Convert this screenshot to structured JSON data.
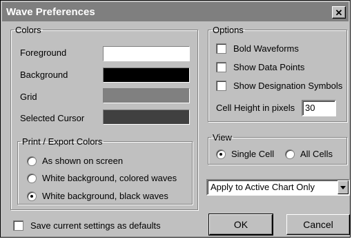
{
  "window": {
    "title": "Wave Preferences",
    "close_glyph": "✕"
  },
  "colors_group": {
    "legend": "Colors",
    "rows": [
      {
        "label": "Foreground",
        "color": "#ffffff"
      },
      {
        "label": "Background",
        "color": "#000000"
      },
      {
        "label": "Grid",
        "color": "#808080"
      },
      {
        "label": "Selected Cursor",
        "color": "#404040"
      }
    ],
    "print_export": {
      "legend": "Print / Export Colors",
      "options": [
        {
          "label": "As shown on screen",
          "selected": false
        },
        {
          "label": "White background, colored waves",
          "selected": false
        },
        {
          "label": "White background, black waves",
          "selected": true
        }
      ]
    }
  },
  "options_group": {
    "legend": "Options",
    "checkboxes": [
      {
        "label": "Bold Waveforms",
        "checked": false
      },
      {
        "label": "Show Data Points",
        "checked": false
      },
      {
        "label": "Show Designation Symbols",
        "checked": false
      }
    ],
    "cell_height_label": "Cell Height in pixels",
    "cell_height_value": "30"
  },
  "view_group": {
    "legend": "View",
    "options": [
      {
        "label": "Single Cell",
        "selected": true
      },
      {
        "label": "All Cells",
        "selected": false
      }
    ]
  },
  "apply_select": {
    "value": "Apply to Active Chart Only"
  },
  "save_defaults": {
    "label": "Save current settings as defaults",
    "checked": false
  },
  "buttons": {
    "ok": "OK",
    "cancel": "Cancel"
  }
}
